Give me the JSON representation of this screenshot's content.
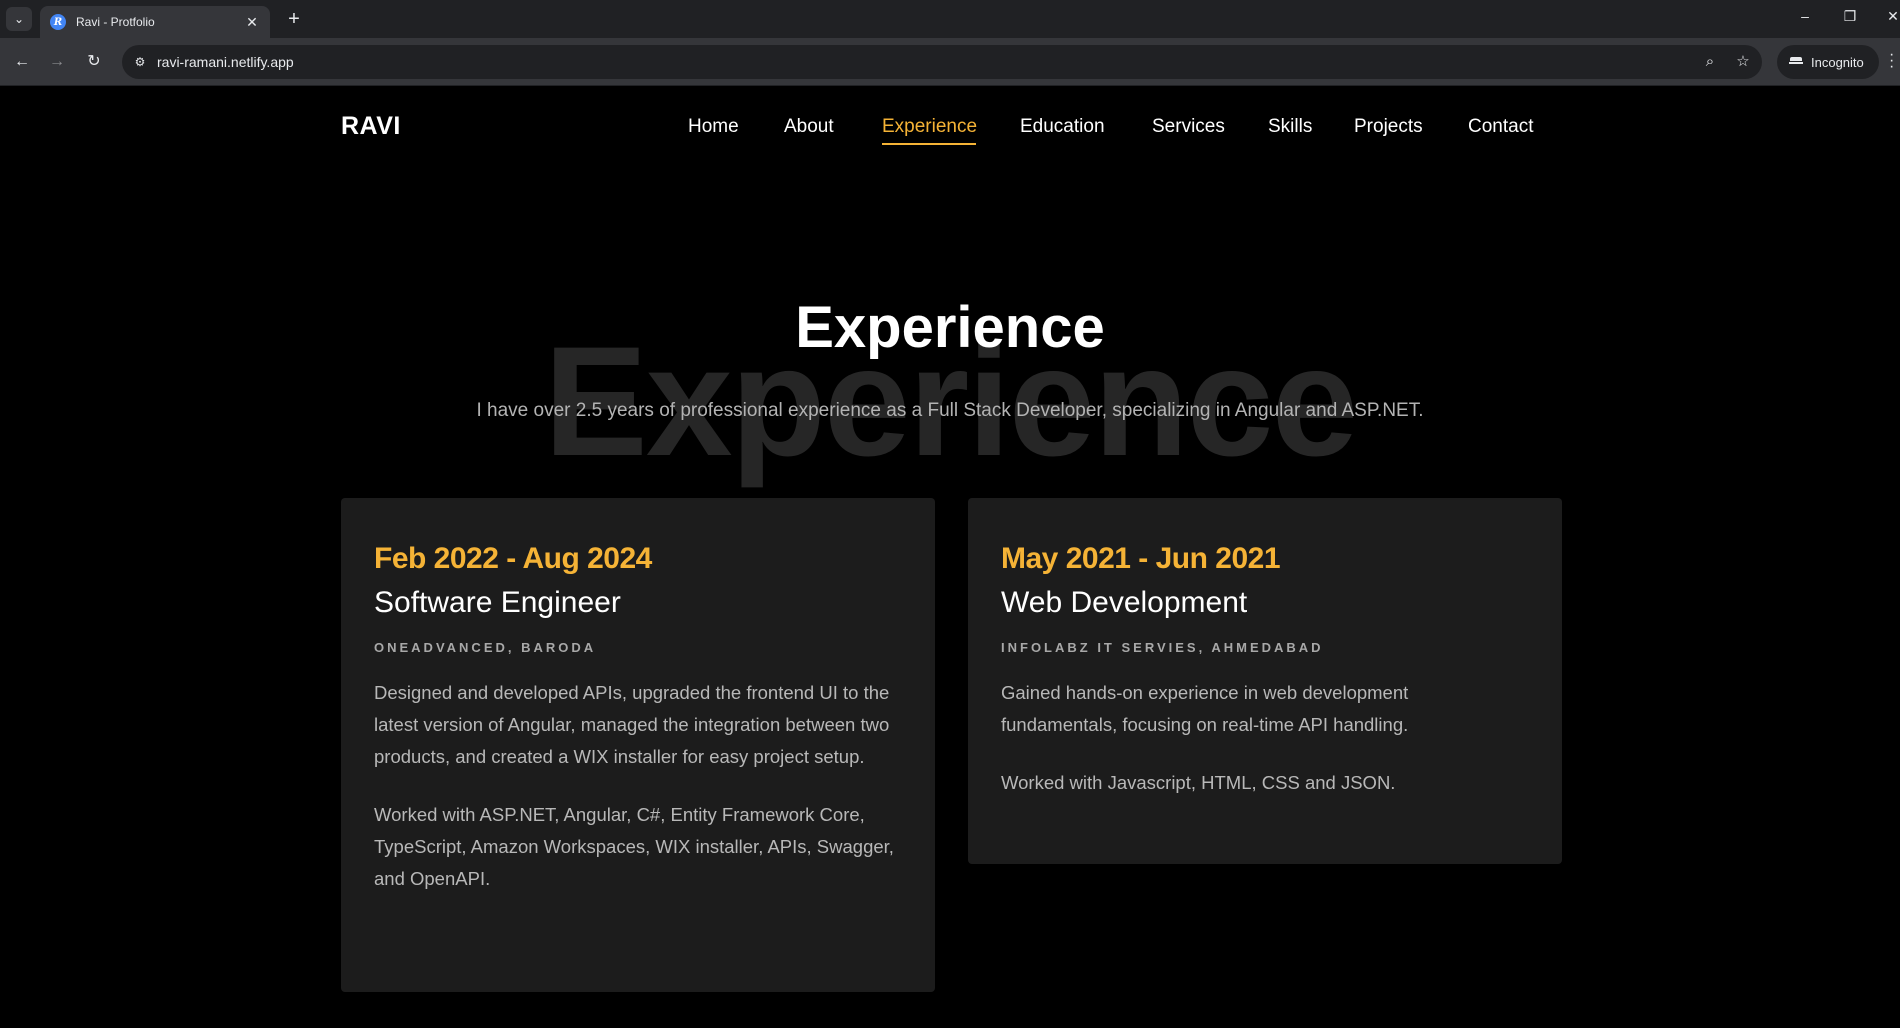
{
  "browser": {
    "tab_title": "Ravi - Protfolio",
    "favicon_letter": "R",
    "url": "ravi-ramani.netlify.app",
    "incognito_label": "Incognito"
  },
  "site": {
    "brand": "RAVI",
    "nav": [
      {
        "label": "Home"
      },
      {
        "label": "About"
      },
      {
        "label": "Experience",
        "active": true
      },
      {
        "label": "Education"
      },
      {
        "label": "Services"
      },
      {
        "label": "Skills"
      },
      {
        "label": "Projects"
      },
      {
        "label": "Contact"
      }
    ],
    "accent_color": "#f5b336"
  },
  "section": {
    "title": "Experience",
    "background_title": "Experience",
    "subtitle": "I have over 2.5 years of professional experience as a Full Stack Developer, specializing in Angular and ASP.NET."
  },
  "experience": [
    {
      "date": "Feb 2022 - Aug 2024",
      "role": "Software Engineer",
      "company": "ONEADVANCED, BARODA",
      "description": "Designed and developed APIs, upgraded the frontend UI to the latest version of Angular, managed the integration between two products, and created a WIX installer for easy project setup.",
      "tech": "Worked with ASP.NET, Angular, C#, Entity Framework Core, TypeScript, Amazon Workspaces, WIX installer, APIs, Swagger, and OpenAPI."
    },
    {
      "date": "May 2021 - Jun 2021",
      "role": "Web Development",
      "company": "INFOLABZ IT SERVIES, AHMEDABAD",
      "description": "Gained hands-on experience in web development fundamentals, focusing on real-time API handling.",
      "tech": "Worked with Javascript, HTML, CSS and JSON."
    }
  ]
}
